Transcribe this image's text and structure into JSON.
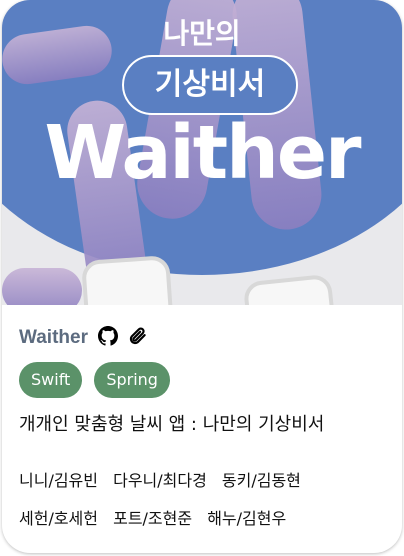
{
  "hero": {
    "line1": "나만의",
    "line2": "기상비서",
    "line3": "Waither"
  },
  "project": {
    "name": "Waither",
    "icons": [
      "github-icon",
      "paperclip-icon"
    ],
    "tags": [
      "Swift",
      "Spring"
    ],
    "tag_color": "#5b9269",
    "description": "개개인 맞춤형 날씨 앱 : 나만의 기상비서",
    "members": [
      "니니/김유빈",
      "다우니/최다경",
      "동키/김동현",
      "세헌/호세헌",
      "포트/조현준",
      "해누/김현우"
    ]
  }
}
